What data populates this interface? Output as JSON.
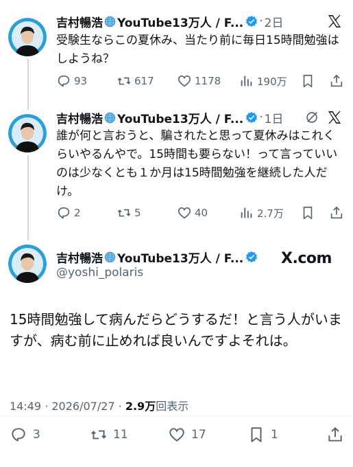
{
  "author": {
    "name": "吉村暢浩",
    "channel": "YouTube13万人 / F...",
    "handle": "@yoshi_polaris"
  },
  "tweets": [
    {
      "time": "2日",
      "text": "受験生ならこの夏休み、当たり前に毎日15時間勉強はしようね？",
      "replies": "93",
      "retweets": "617",
      "likes": "1178",
      "views": "190万"
    },
    {
      "time": "1日",
      "text": "誰が何と言おうと、騙されたと思って夏休みはこれくらいやるんやで。15時間も要らない！って言っていいのは少なくとも１か月は15時間勉強を継続した人だけ。",
      "replies": "2",
      "retweets": "5",
      "likes": "40",
      "views": "2.7万"
    }
  ],
  "main_tweet": {
    "text": "15時間勉強して病んだらどうするだ！と言う人がいますが、病む前に止めれば良いんですよそれは。",
    "timestamp": "14:49 · 2026/07/27 · ",
    "views_count": "2.9万",
    "views_label": "回表示",
    "replies": "3",
    "retweets": "11",
    "likes": "17",
    "bookmarks": "1"
  },
  "watermark": "X.com",
  "colors": {
    "verified": "#1d9bf0",
    "muted": "#536471",
    "text": "#0f1419"
  },
  "icons": [
    "x-logo-icon",
    "globe-icon",
    "verified-badge-icon",
    "grok-icon",
    "reply-icon",
    "retweet-icon",
    "like-icon",
    "views-icon",
    "bookmark-icon",
    "share-icon"
  ]
}
